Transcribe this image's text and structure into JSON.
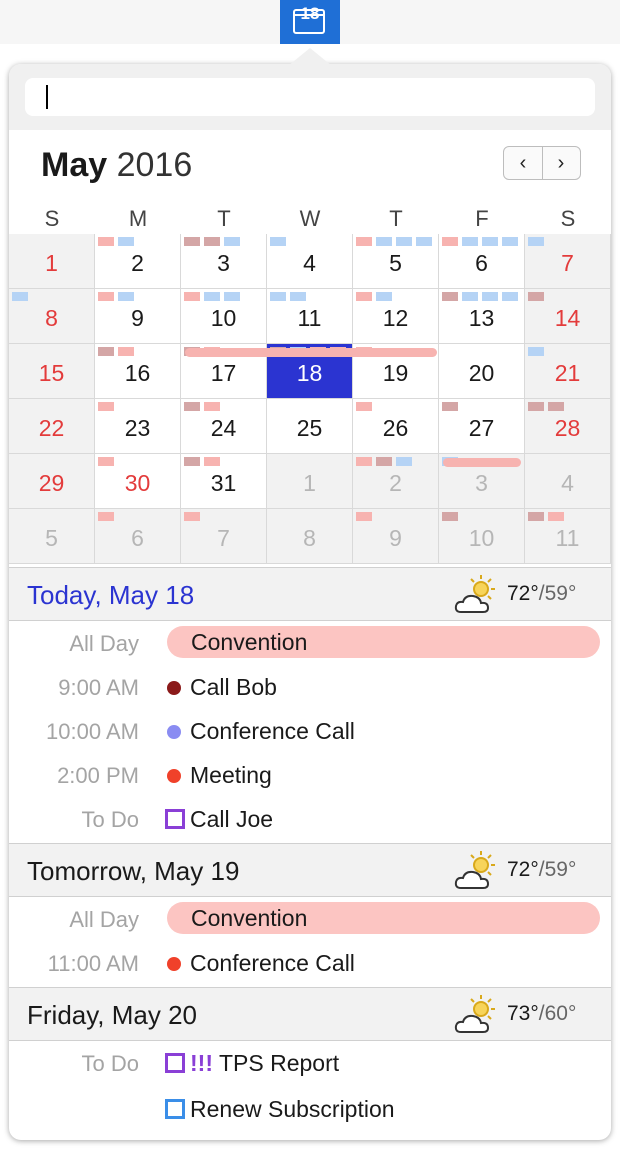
{
  "menubar": {
    "day_icon": "18"
  },
  "search": {
    "value": ""
  },
  "calendar": {
    "month": "May",
    "year": "2016",
    "nav_prev": "‹",
    "nav_next": "›",
    "weekdays": [
      "S",
      "M",
      "T",
      "W",
      "T",
      "F",
      "S"
    ],
    "weeks": [
      [
        "1",
        "2",
        "3",
        "4",
        "5",
        "6",
        "7"
      ],
      [
        "8",
        "9",
        "10",
        "11",
        "12",
        "13",
        "14"
      ],
      [
        "15",
        "16",
        "17",
        "18",
        "19",
        "20",
        "21"
      ],
      [
        "22",
        "23",
        "24",
        "25",
        "26",
        "27",
        "28"
      ],
      [
        "29",
        "30",
        "31",
        "1",
        "2",
        "3",
        "4"
      ],
      [
        "5",
        "6",
        "7",
        "8",
        "9",
        "10",
        "11"
      ]
    ],
    "today": "18"
  },
  "colors": {
    "accent": "#2b34d1",
    "weekend_red": "#e33b3b",
    "event_pink": "#fcc5c2",
    "event_blue": "#b5d3f5",
    "event_dark": "#d4a6a6",
    "call_bob": "#8b1a1a",
    "conference": "#8a8cf2",
    "meeting": "#f0412a",
    "todo_purple": "#8a3fd6",
    "todo_blue": "#3a8ee8"
  },
  "days": [
    {
      "title": "Today, May 18",
      "weather_icon": "partly-cloudy-icon",
      "temp_hi": "72°",
      "temp_lo": "/59°",
      "events": [
        {
          "label": "All Day",
          "text": "Convention",
          "kind": "allday"
        },
        {
          "label": "9:00 AM",
          "text": "Call Bob",
          "kind": "dot"
        },
        {
          "label": "10:00 AM",
          "text": "Conference Call",
          "kind": "dot"
        },
        {
          "label": "2:00 PM",
          "text": "Meeting",
          "kind": "dot"
        },
        {
          "label": "To Do",
          "text": "Call Joe",
          "kind": "todo"
        }
      ]
    },
    {
      "title": "Tomorrow, May 19",
      "weather_icon": "partly-cloudy-icon",
      "temp_hi": "72°",
      "temp_lo": "/59°",
      "events": [
        {
          "label": "All Day",
          "text": "Convention",
          "kind": "allday"
        },
        {
          "label": "11:00 AM",
          "text": "Conference Call",
          "kind": "dot"
        }
      ]
    },
    {
      "title": "Friday, May 20",
      "weather_icon": "partly-cloudy-icon",
      "temp_hi": "73°",
      "temp_lo": "/60°",
      "events": [
        {
          "label": "To Do",
          "text": "TPS Report",
          "priority": "!!!",
          "kind": "todo"
        },
        {
          "label": "",
          "text": "Renew Subscription",
          "kind": "todo"
        }
      ]
    }
  ]
}
